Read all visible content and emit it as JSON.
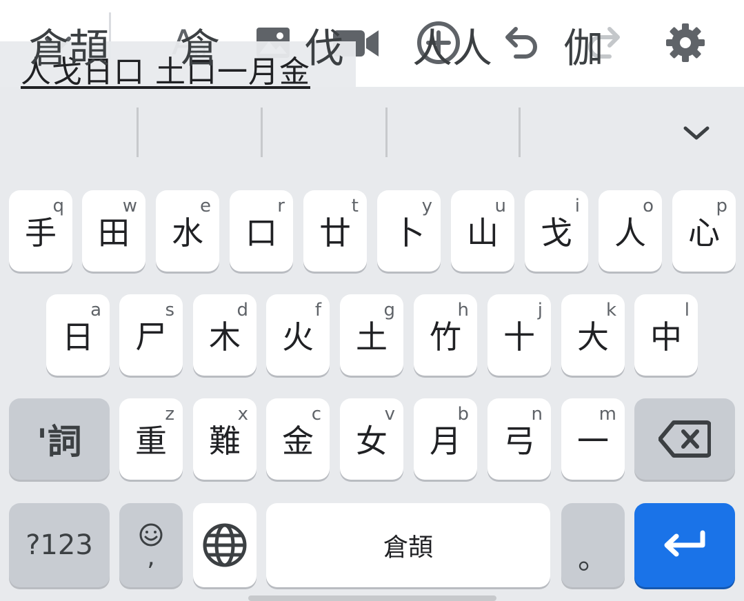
{
  "composing_text": "人戈日口 土口一月金",
  "toolbar": {
    "icons": [
      "close-icon",
      "text-style-icon",
      "image-icon",
      "video-icon",
      "add-circle-icon",
      "undo-icon",
      "redo-icon",
      "gear-icon"
    ]
  },
  "suggestions": [
    "倉頡",
    "倉",
    "伐",
    "人人",
    "伽"
  ],
  "rows": {
    "row1": [
      {
        "main": "手",
        "hint": "q"
      },
      {
        "main": "田",
        "hint": "w"
      },
      {
        "main": "水",
        "hint": "e"
      },
      {
        "main": "口",
        "hint": "r"
      },
      {
        "main": "廿",
        "hint": "t"
      },
      {
        "main": "卜",
        "hint": "y"
      },
      {
        "main": "山",
        "hint": "u"
      },
      {
        "main": "戈",
        "hint": "i"
      },
      {
        "main": "人",
        "hint": "o"
      },
      {
        "main": "心",
        "hint": "p"
      }
    ],
    "row2": [
      {
        "main": "日",
        "hint": "a"
      },
      {
        "main": "尸",
        "hint": "s"
      },
      {
        "main": "木",
        "hint": "d"
      },
      {
        "main": "火",
        "hint": "f"
      },
      {
        "main": "土",
        "hint": "g"
      },
      {
        "main": "竹",
        "hint": "h"
      },
      {
        "main": "十",
        "hint": "j"
      },
      {
        "main": "大",
        "hint": "k"
      },
      {
        "main": "中",
        "hint": "l"
      }
    ],
    "row3": [
      {
        "main": "重",
        "hint": "z"
      },
      {
        "main": "難",
        "hint": "x"
      },
      {
        "main": "金",
        "hint": "c"
      },
      {
        "main": "女",
        "hint": "v"
      },
      {
        "main": "月",
        "hint": "b"
      },
      {
        "main": "弓",
        "hint": "n"
      },
      {
        "main": "一",
        "hint": "m"
      }
    ]
  },
  "special": {
    "word_key": "'詞",
    "symbols_key": "?123",
    "emoji_sub": ",",
    "space_label": "倉頡",
    "period_key": "。"
  }
}
